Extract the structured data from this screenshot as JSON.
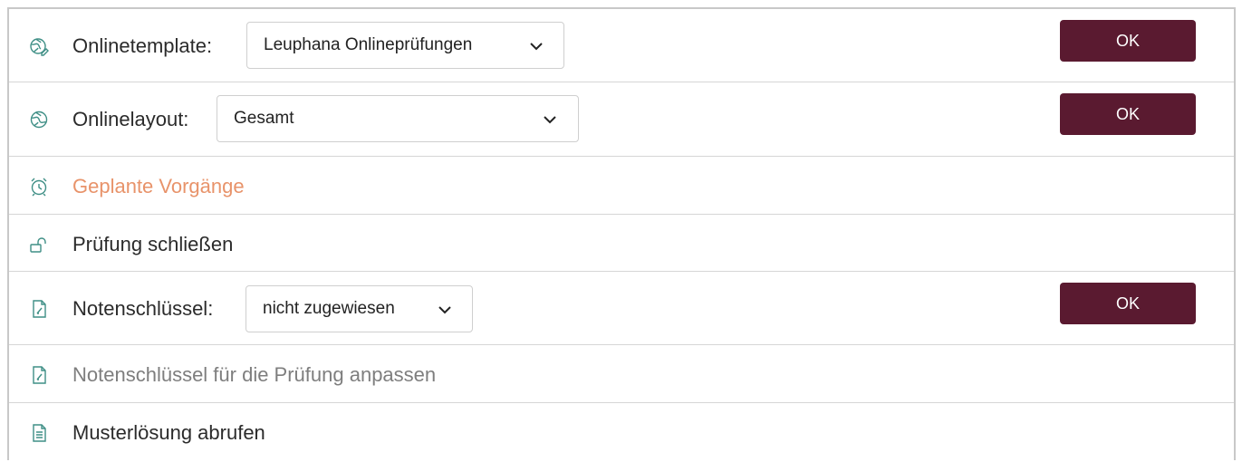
{
  "rows": [
    {
      "icon": "globe-edit-icon",
      "label": "Onlinetemplate:",
      "select_value": "Leuphana Onlineprüfungen",
      "button": "OK"
    },
    {
      "icon": "globe-icon",
      "label": "Onlinelayout:",
      "select_value": "Gesamt",
      "button": "OK"
    },
    {
      "icon": "alarm-clock-icon",
      "label": "Geplante Vorgänge",
      "color": "#e8936a"
    },
    {
      "icon": "unlock-icon",
      "label": "Prüfung schließen"
    },
    {
      "icon": "document-edit-icon",
      "label": "Notenschlüssel:",
      "select_value": "nicht zugewiesen",
      "button": "OK"
    },
    {
      "icon": "document-edit-icon",
      "label": "Notenschlüssel für die Prüfung anpassen",
      "color": "#7e7e7e"
    },
    {
      "icon": "document-text-icon",
      "label": "Musterlösung abrufen"
    }
  ],
  "colors": {
    "accent_button": "#5a1a30",
    "icon": "#3f8f86",
    "link_orange": "#e8936a"
  }
}
